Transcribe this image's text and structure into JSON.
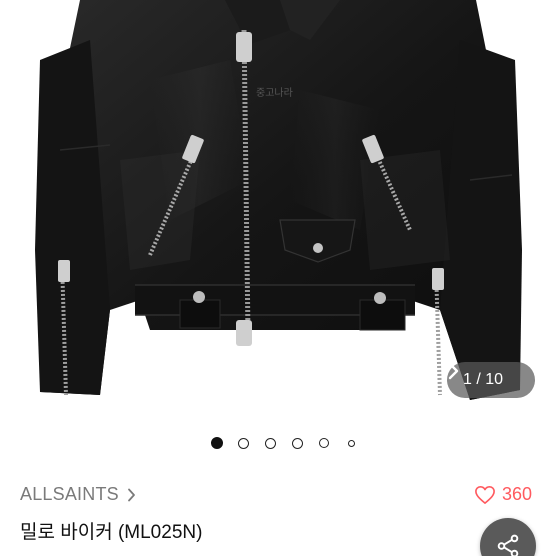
{
  "product_image": {
    "watermark": "중고나라",
    "counter": "1 / 10",
    "dots_total": 6,
    "active_dot": 0
  },
  "product": {
    "brand": "ALLSAINTS",
    "title": "밀로 바이커 (ML025N)",
    "like_count": "360"
  },
  "colors": {
    "like": "#ff5a5f",
    "brand_text": "#7a7a7a",
    "fab": "#5a5a5a"
  },
  "icons": {
    "prev": "chevron-left-icon",
    "next": "chevron-right-icon",
    "brand_chevron": "chevron-right-icon",
    "like": "heart-outline-icon",
    "share": "share-icon"
  }
}
